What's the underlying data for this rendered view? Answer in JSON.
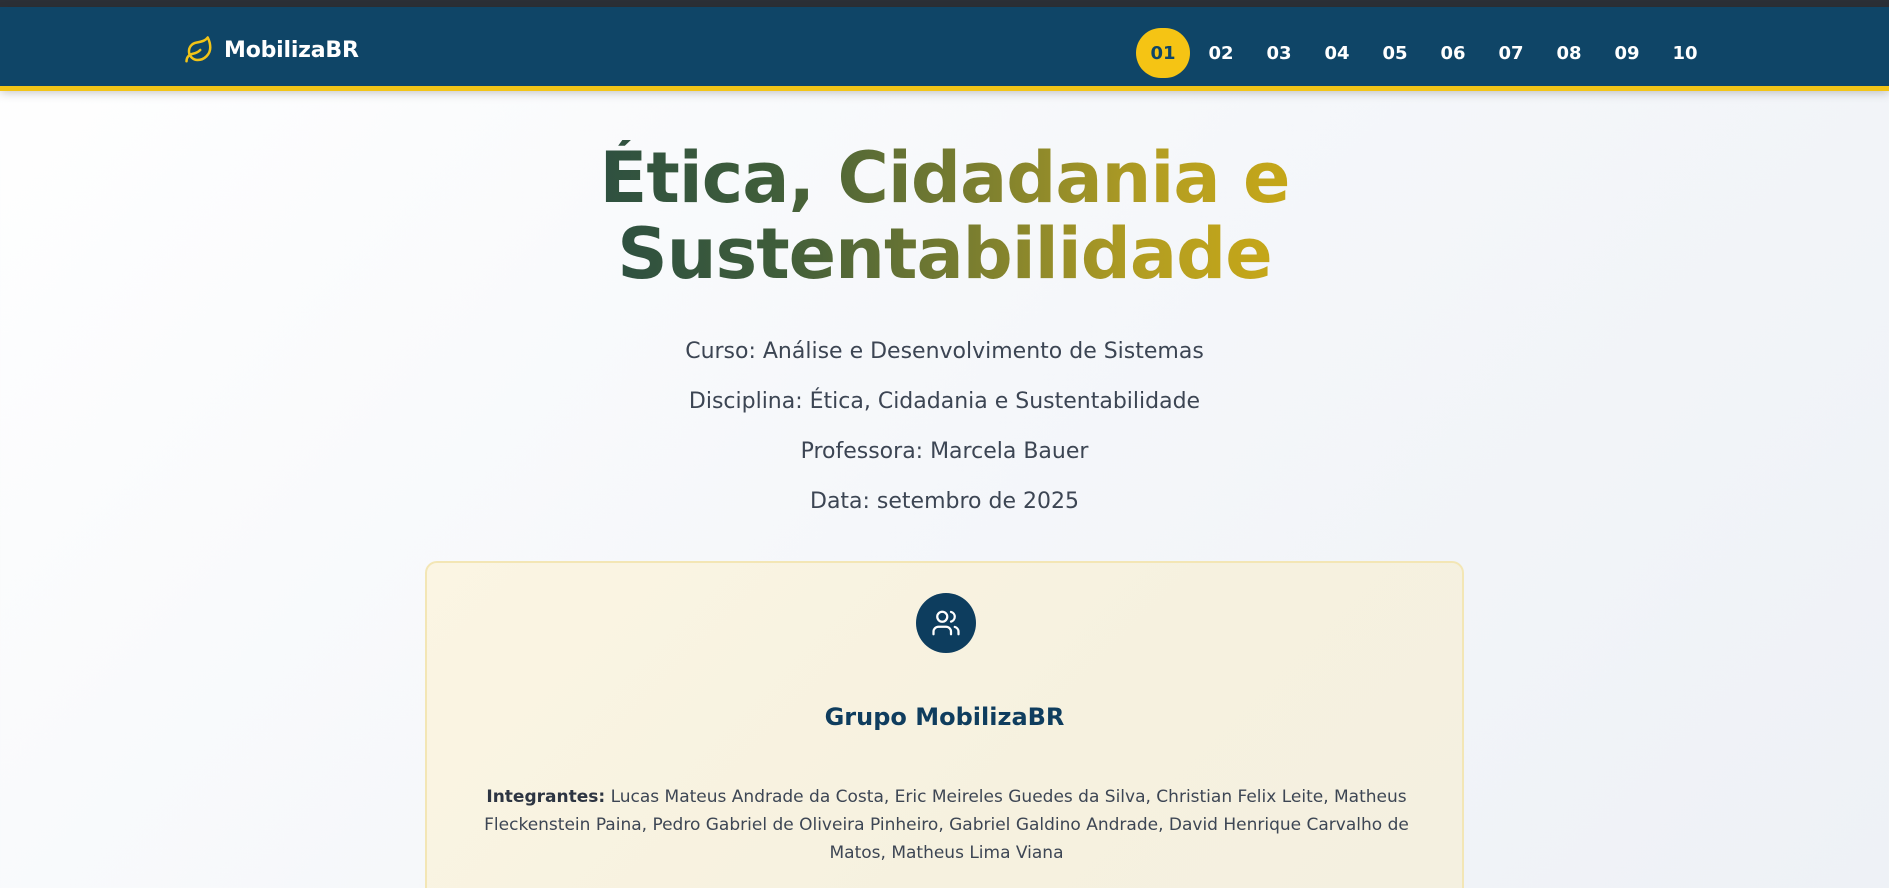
{
  "brand": {
    "name": "MobilizaBR",
    "icon": "leaf-icon",
    "accent_color": "#f2c417",
    "nav_color": "#0f4567"
  },
  "nav": {
    "pages": [
      "01",
      "02",
      "03",
      "04",
      "05",
      "06",
      "07",
      "08",
      "09",
      "10"
    ],
    "active_page": "01"
  },
  "hero": {
    "title_line1": "Ética, Cidadania e",
    "title_line2": "Sustentabilidade",
    "course": "Curso: Análise e Desenvolvimento de Sistemas",
    "discipline": "Disciplina: Ética, Cidadania e Sustentabilidade",
    "professor": "Professora: Marcela Bauer",
    "date": "Data: setembro de 2025"
  },
  "group_card": {
    "icon": "users-icon",
    "title": "Grupo MobilizaBR",
    "members_label": "Integrantes:",
    "members": "Lucas Mateus Andrade da Costa, Eric Meireles Guedes da Silva, Christian Felix Leite, Matheus Fleckenstein Paina, Pedro Gabriel de Oliveira Pinheiro, Gabriel Galdino Andrade, David Henrique Carvalho de Matos, Matheus Lima Viana"
  }
}
